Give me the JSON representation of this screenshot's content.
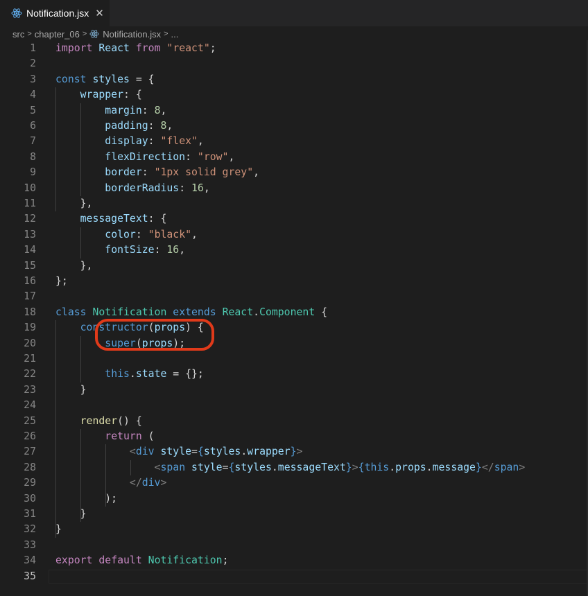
{
  "tab": {
    "filename": "Notification.jsx",
    "close_symbol": "✕",
    "icon": "react-icon"
  },
  "breadcrumb": [
    "src",
    "chapter_06",
    "Notification.jsx",
    "..."
  ],
  "colors": {
    "keyword": "#569cd6",
    "control": "#c586c0",
    "variable": "#9cdcfe",
    "string": "#ce9178",
    "number": "#b5cea8",
    "type": "#4ec9b0",
    "function": "#dcdcaa",
    "annotation": "#e03a1a"
  },
  "lines": [
    [
      [
        "c",
        "import"
      ],
      [
        "w",
        " "
      ],
      [
        "v",
        "React"
      ],
      [
        "w",
        " "
      ],
      [
        "c",
        "from"
      ],
      [
        "w",
        " "
      ],
      [
        "s",
        "\"react\""
      ],
      [
        "w",
        ";"
      ]
    ],
    [],
    [
      [
        "k",
        "const"
      ],
      [
        "w",
        " "
      ],
      [
        "v",
        "styles"
      ],
      [
        "w",
        " = {"
      ]
    ],
    [
      [
        "w",
        "    "
      ],
      [
        "v",
        "wrapper"
      ],
      [
        "w",
        ": {"
      ]
    ],
    [
      [
        "w",
        "        "
      ],
      [
        "v",
        "margin"
      ],
      [
        "w",
        ": "
      ],
      [
        "n",
        "8"
      ],
      [
        "w",
        ","
      ]
    ],
    [
      [
        "w",
        "        "
      ],
      [
        "v",
        "padding"
      ],
      [
        "w",
        ": "
      ],
      [
        "n",
        "8"
      ],
      [
        "w",
        ","
      ]
    ],
    [
      [
        "w",
        "        "
      ],
      [
        "v",
        "display"
      ],
      [
        "w",
        ": "
      ],
      [
        "s",
        "\"flex\""
      ],
      [
        "w",
        ","
      ]
    ],
    [
      [
        "w",
        "        "
      ],
      [
        "v",
        "flexDirection"
      ],
      [
        "w",
        ": "
      ],
      [
        "s",
        "\"row\""
      ],
      [
        "w",
        ","
      ]
    ],
    [
      [
        "w",
        "        "
      ],
      [
        "v",
        "border"
      ],
      [
        "w",
        ": "
      ],
      [
        "s",
        "\"1px solid grey\""
      ],
      [
        "w",
        ","
      ]
    ],
    [
      [
        "w",
        "        "
      ],
      [
        "v",
        "borderRadius"
      ],
      [
        "w",
        ": "
      ],
      [
        "n",
        "16"
      ],
      [
        "w",
        ","
      ]
    ],
    [
      [
        "w",
        "    },"
      ]
    ],
    [
      [
        "w",
        "    "
      ],
      [
        "v",
        "messageText"
      ],
      [
        "w",
        ": {"
      ]
    ],
    [
      [
        "w",
        "        "
      ],
      [
        "v",
        "color"
      ],
      [
        "w",
        ": "
      ],
      [
        "s",
        "\"black\""
      ],
      [
        "w",
        ","
      ]
    ],
    [
      [
        "w",
        "        "
      ],
      [
        "v",
        "fontSize"
      ],
      [
        "w",
        ": "
      ],
      [
        "n",
        "16"
      ],
      [
        "w",
        ","
      ]
    ],
    [
      [
        "w",
        "    },"
      ]
    ],
    [
      [
        "w",
        "};"
      ]
    ],
    [],
    [
      [
        "k",
        "class"
      ],
      [
        "w",
        " "
      ],
      [
        "t",
        "Notification"
      ],
      [
        "w",
        " "
      ],
      [
        "k",
        "extends"
      ],
      [
        "w",
        " "
      ],
      [
        "t",
        "React"
      ],
      [
        "w",
        "."
      ],
      [
        "t",
        "Component"
      ],
      [
        "w",
        " {"
      ]
    ],
    [
      [
        "w",
        "    "
      ],
      [
        "k",
        "constructor"
      ],
      [
        "w",
        "("
      ],
      [
        "v",
        "props"
      ],
      [
        "w",
        ") {"
      ]
    ],
    [
      [
        "w",
        "        "
      ],
      [
        "k",
        "super"
      ],
      [
        "w",
        "("
      ],
      [
        "v",
        "props"
      ],
      [
        "w",
        ");"
      ]
    ],
    [],
    [
      [
        "w",
        "        "
      ],
      [
        "k",
        "this"
      ],
      [
        "w",
        "."
      ],
      [
        "v",
        "state"
      ],
      [
        "w",
        " = {};"
      ]
    ],
    [
      [
        "w",
        "    }"
      ]
    ],
    [],
    [
      [
        "w",
        "    "
      ],
      [
        "f",
        "render"
      ],
      [
        "w",
        "() {"
      ]
    ],
    [
      [
        "w",
        "        "
      ],
      [
        "c",
        "return"
      ],
      [
        "w",
        " ("
      ]
    ],
    [
      [
        "w",
        "            "
      ],
      [
        "g",
        "<"
      ],
      [
        "k",
        "div"
      ],
      [
        "w",
        " "
      ],
      [
        "v",
        "style"
      ],
      [
        "w",
        "="
      ],
      [
        "k",
        "{"
      ],
      [
        "v",
        "styles"
      ],
      [
        "w",
        "."
      ],
      [
        "v",
        "wrapper"
      ],
      [
        "k",
        "}"
      ],
      [
        "g",
        ">"
      ]
    ],
    [
      [
        "w",
        "                "
      ],
      [
        "g",
        "<"
      ],
      [
        "k",
        "span"
      ],
      [
        "w",
        " "
      ],
      [
        "v",
        "style"
      ],
      [
        "w",
        "="
      ],
      [
        "k",
        "{"
      ],
      [
        "v",
        "styles"
      ],
      [
        "w",
        "."
      ],
      [
        "v",
        "messageText"
      ],
      [
        "k",
        "}"
      ],
      [
        "g",
        ">"
      ],
      [
        "k",
        "{"
      ],
      [
        "k",
        "this"
      ],
      [
        "w",
        "."
      ],
      [
        "v",
        "props"
      ],
      [
        "w",
        "."
      ],
      [
        "v",
        "message"
      ],
      [
        "k",
        "}"
      ],
      [
        "g",
        "</"
      ],
      [
        "k",
        "span"
      ],
      [
        "g",
        ">"
      ]
    ],
    [
      [
        "w",
        "            "
      ],
      [
        "g",
        "</"
      ],
      [
        "k",
        "div"
      ],
      [
        "g",
        ">"
      ]
    ],
    [
      [
        "w",
        "        );"
      ]
    ],
    [
      [
        "w",
        "    }"
      ]
    ],
    [
      [
        "w",
        "}"
      ]
    ],
    [],
    [
      [
        "c",
        "export"
      ],
      [
        "w",
        " "
      ],
      [
        "c",
        "default"
      ],
      [
        "w",
        " "
      ],
      [
        "t",
        "Notification"
      ],
      [
        "w",
        ";"
      ]
    ],
    []
  ],
  "line_numbers": [
    "1",
    "2",
    "3",
    "4",
    "5",
    "6",
    "7",
    "8",
    "9",
    "10",
    "11",
    "12",
    "13",
    "14",
    "15",
    "16",
    "17",
    "18",
    "19",
    "20",
    "21",
    "22",
    "23",
    "24",
    "25",
    "26",
    "27",
    "28",
    "29",
    "30",
    "31",
    "32",
    "33",
    "34",
    "35"
  ],
  "active_line": 35
}
